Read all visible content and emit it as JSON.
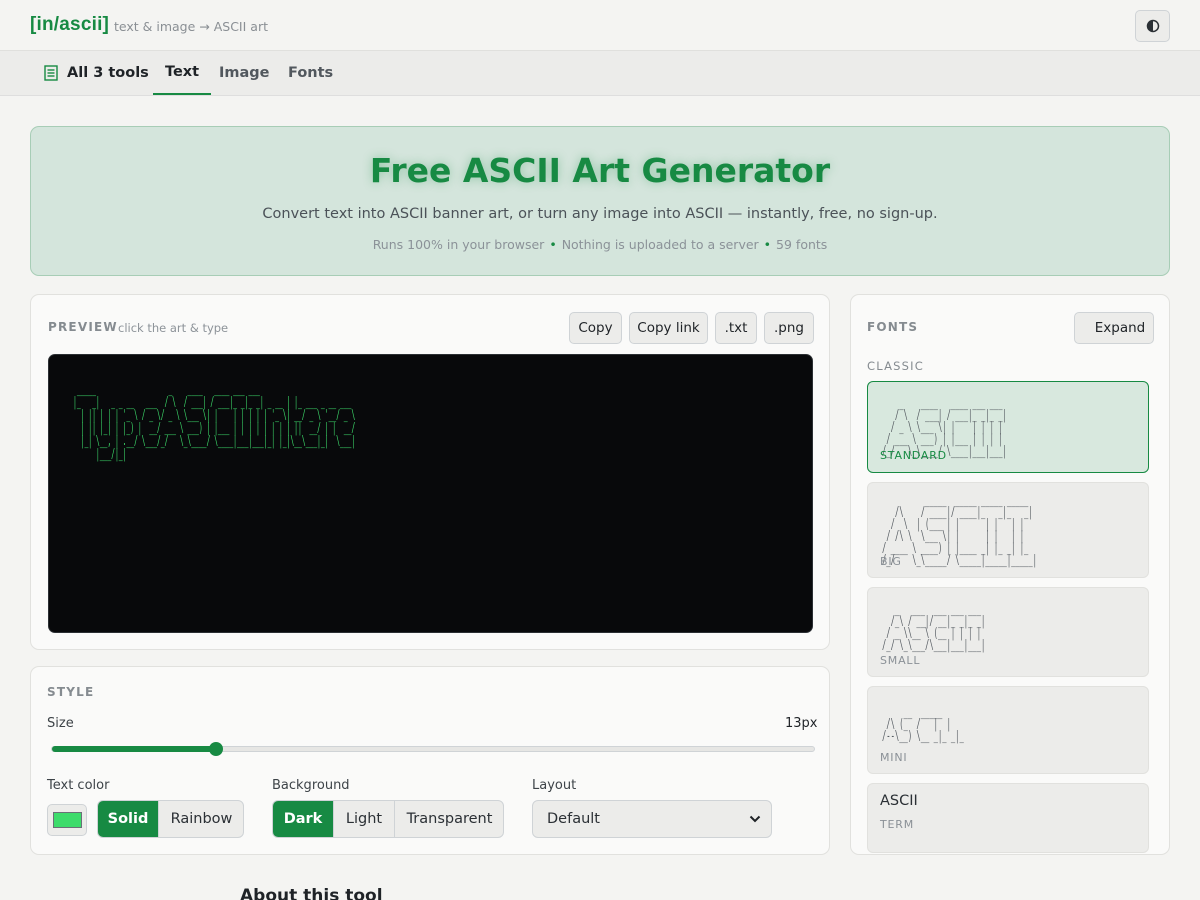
{
  "header": {
    "logo": "[in/ascii]",
    "tagline": "text & image → ASCII art"
  },
  "tabs": {
    "all": "All 3 tools",
    "text": "Text",
    "image": "Image",
    "fonts": "Fonts"
  },
  "hero": {
    "title": "Free ASCII Art Generator",
    "subtitle": "Convert text into ASCII banner art, or turn any image into ASCII — instantly, free, no sign-up.",
    "meta_1": "Runs 100% in your browser",
    "meta_2": "Nothing is uploaded to a server",
    "meta_3": "59 fonts"
  },
  "preview": {
    "label": "PREVIEW",
    "hint": "click the art & type",
    "copy": "Copy",
    "copy_link": "Copy link",
    "txt": ".txt",
    "png": ".png",
    "art": " _____                   _    ____   ____ ___ ___  \n|_   _|   _ _ __   ___  / \\  / ___| / ___|_ _|_ _| _ __ | |_ ___ _ __ ___ \n  | || | | | '_ \\ / _ \\/ _ \\ \\___ \\| |    | | | | | '_ \\| __/ _ \\ '__/ _ \\\n  | || |_| | |_) |  __/ ___ \\ ___) | |___ | | | | | | | | ||  __/ | |  __/\n  |_| \\__, | .__/ \\___/_/   \\_\\____/ \\____|___|___|_| |_|\\__\\___|_|  \\___|\n      |___/|_|"
  },
  "style": {
    "label": "STYLE",
    "size_label": "Size",
    "size_value": "13px",
    "size_fraction": 0.215,
    "text_color_label": "Text color",
    "text_color": "#3ddc6b",
    "solid": "Solid",
    "rainbow": "Rainbow",
    "background_label": "Background",
    "dark": "Dark",
    "light": "Light",
    "transparent": "Transparent",
    "layout_label": "Layout",
    "layout_value": "Default"
  },
  "fonts": {
    "label": "FONTS",
    "expand": "Expand",
    "category": "CLASSIC",
    "items": [
      {
        "name": "STANDARD",
        "art": "    _    ____   ____ ___ ___ \n   / \\  / ___| / ___|_ _|_ _|\n  / _ \\ \\___ \\| |    | | | | \n / ___ \\ ___) | |___ | | | | \n/_/   \\_\\____/ \\____|___|___|"
      },
      {
        "name": "BIG",
        "art": "          _____  _____ _____ _____ \n   /\\    / ____|/ ____|_   _|_   _|\n  /  \\  | (___ | |      | |   | |  \n / /\\ \\  \\___ \\| |      | |   | |  \n/ ____ \\ ____) | |____ _| |_ _| |_ \n/_/    \\_\\_____/ \\_____|_____|_____|"
      },
      {
        "name": "SMALL",
        "art": "   _   ___  ___ ___ ___ \n  /_\\ / __|/ __|_ _|_ _|\n / _ \\\\__ \\ (__ | | | | \n/_/ \\_\\___/\\___|___|___|"
      },
      {
        "name": "MINI",
        "art": "     __  _____ \n /\\ (_  /   |  | \n/--\\__) \\__ _|_ _|_"
      },
      {
        "name": "TERM",
        "plain": "ASCII"
      }
    ]
  },
  "about": "About this tool"
}
